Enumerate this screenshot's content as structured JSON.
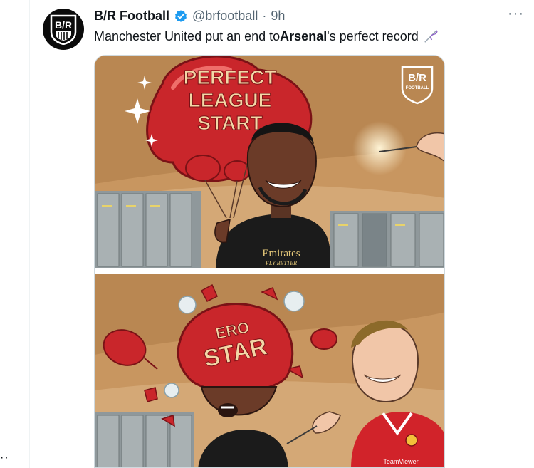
{
  "tweet": {
    "author_name": "B/R Football",
    "handle": "@brfootball",
    "separator": "·",
    "time": "9h",
    "more_label": "···",
    "text_parts": [
      "Manchester United put an end to ",
      "Arsenal",
      "'s perfect record"
    ],
    "avatar_text": "B/R"
  },
  "media": {
    "balloon_text": [
      "PERFECT",
      "LEAGUE",
      "START"
    ],
    "popped_text": [
      "ERO",
      "STAR"
    ],
    "logo_text": "B/R",
    "logo_sub": "FOOTBALL",
    "shirt_sponsor": "Emirates",
    "shirt_sponsor_sub": "FLY BETTER",
    "united_sponsor": "TeamViewer"
  },
  "left_edge": {
    "dots": "··"
  },
  "colors": {
    "verified": "#1d9bf0",
    "balloon_red": "#c9262b",
    "balloon_text": "#f3d7a6",
    "background_warm": "#c89660",
    "locker_grey": "#9aa3a6",
    "arsenal_shirt": "#1b1b1b",
    "united_shirt": "#d1232a"
  }
}
